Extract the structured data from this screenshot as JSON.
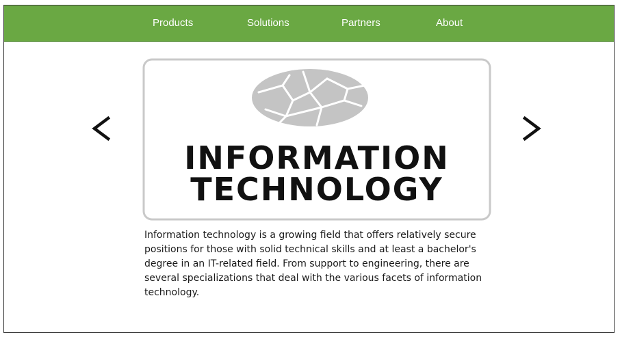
{
  "nav": {
    "items": [
      {
        "label": "Products"
      },
      {
        "label": "Solutions"
      },
      {
        "label": "Partners"
      },
      {
        "label": "About"
      }
    ]
  },
  "carousel": {
    "image_title_line1": "INFORMATION",
    "image_title_line2": "TECHNOLOGY",
    "prev_icon": "chevron-left-icon",
    "next_icon": "chevron-right-icon",
    "description": "Information technology is a growing field that offers relatively secure positions for those with solid technical skills and at least a bachelor's degree in an IT-related field. From support to engineering, there are several specializations that deal with the various facets of information technology."
  },
  "colors": {
    "nav_background": "#6aa843",
    "nav_text": "#ffffff",
    "arrow": "#111111",
    "logo_gray": "#c4c4c4",
    "logo_text": "#111111"
  }
}
